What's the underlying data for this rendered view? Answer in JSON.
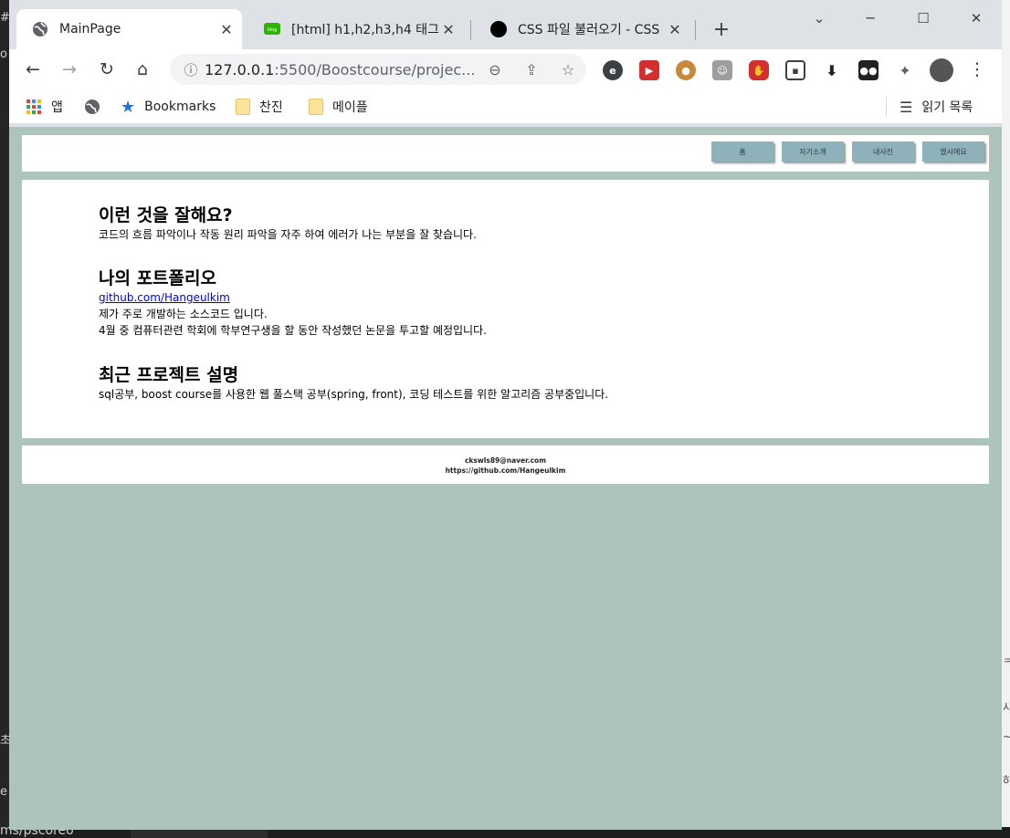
{
  "browser": {
    "tabs": [
      {
        "title": "MainPage",
        "active": true,
        "favicon": "globe-icon"
      },
      {
        "title": "[html] h1,h2,h3,h4 태그 (",
        "active": false,
        "favicon": "blog-icon"
      },
      {
        "title": "CSS 파일 불러오기 - CSS",
        "active": false,
        "favicon": "black-circle-icon"
      }
    ],
    "url_host": "127.0.0.1",
    "url_rest": ":5500/Boostcourse/projec...",
    "bookmarks": {
      "apps": "앱",
      "bookmarks": "Bookmarks",
      "folder1": "찬진",
      "folder2": "메이플",
      "reading_list": "읽기 목록"
    }
  },
  "page": {
    "nav": {
      "home": "홈",
      "intro": "자기소개",
      "photos": "내사진",
      "contact": "옜시에요"
    },
    "sections": [
      {
        "heading": "이런 것을 잘해요?",
        "lines": [
          "코드의 흐름 파악이나 작동 원리 파악을 자주 하여 에러가 나는 부분을 잘 찾습니다."
        ]
      },
      {
        "heading": "나의 포트폴리오",
        "link": "github.com/Hangeulkim",
        "lines": [
          "제가 주로 개발하는 소스코드 입니다.",
          "4월 중 컴퓨터관련 학회에 학부연구생을 할 동안 작성했던 논문을 투고할 예정입니다."
        ]
      },
      {
        "heading": "최근 프로젝트 설명",
        "lines": [
          "sql공부, boost course를 사용한 웹 풀스택 공부(spring, front), 코딩 테스트를 위한 알고리즘 공부중입니다."
        ]
      }
    ],
    "footer": {
      "email": "ckswls89@naver.com",
      "github": "https://github.com/Hangeulkim"
    }
  }
}
